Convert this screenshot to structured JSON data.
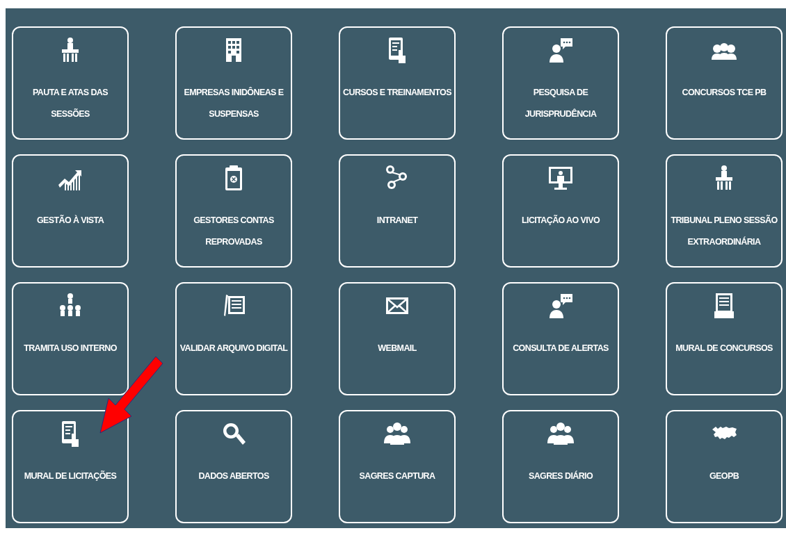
{
  "tiles": [
    {
      "label": "PAUTA E ATAS DAS SESSÕES"
    },
    {
      "label": "EMPRESAS INIDÔNEAS E SUSPENSAS"
    },
    {
      "label": "CURSOS E TREINAMENTOS"
    },
    {
      "label": "PESQUISA DE JURISPRUDÊNCIA"
    },
    {
      "label": "CONCURSOS TCE PB"
    },
    {
      "label": "GESTÃO À VISTA"
    },
    {
      "label": "GESTORES CONTAS REPROVADAS"
    },
    {
      "label": "INTRANET"
    },
    {
      "label": "LICITAÇÃO AO VIVO"
    },
    {
      "label": "TRIBUNAL PLENO SESSÃO EXTRAORDINÁRIA"
    },
    {
      "label": "TRAMITA USO INTERNO"
    },
    {
      "label": "VALIDAR ARQUIVO DIGITAL"
    },
    {
      "label": "WEBMAIL"
    },
    {
      "label": "CONSULTA DE ALERTAS"
    },
    {
      "label": "MURAL DE CONCURSOS"
    },
    {
      "label": "MURAL DE LICITAÇÕES"
    },
    {
      "label": "DADOS ABERTOS"
    },
    {
      "label": "SAGRES CAPTURA"
    },
    {
      "label": "SAGRES DIÁRIO"
    },
    {
      "label": "GEOPB"
    }
  ]
}
